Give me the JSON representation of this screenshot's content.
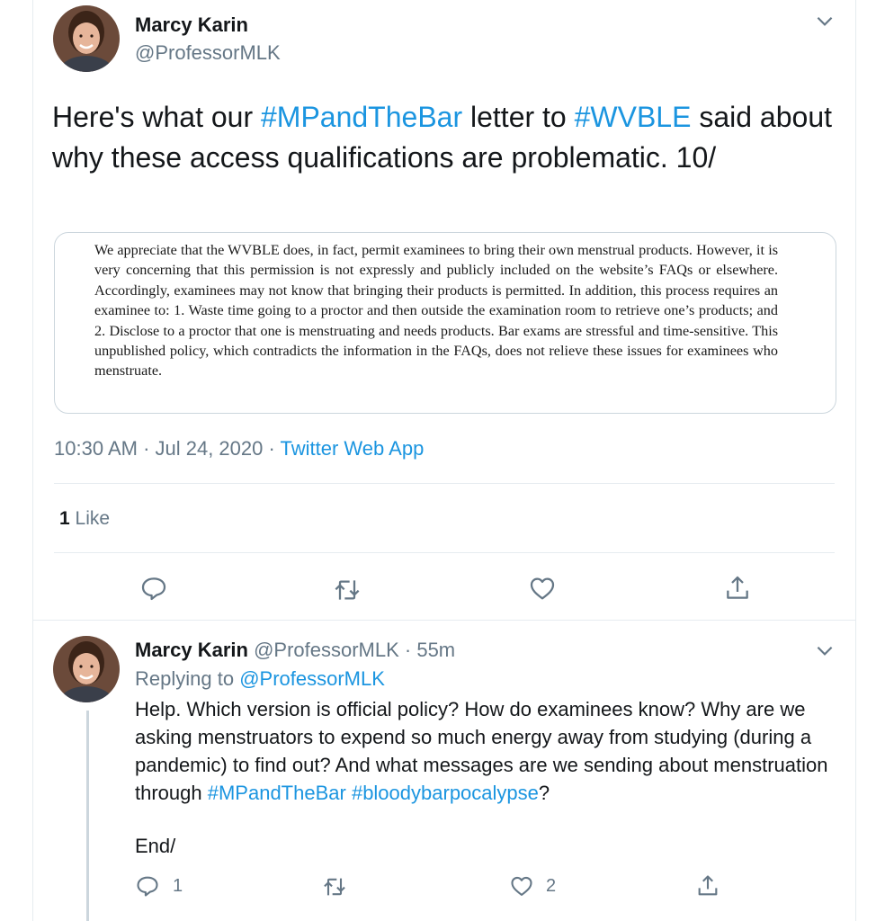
{
  "main_tweet": {
    "author_name": "Marcy Karin",
    "author_handle": "@ProfessorMLK",
    "text_before_1": "Here's what our ",
    "hashtag_1": "#MPandTheBar",
    "text_mid": " letter to ",
    "hashtag_2": "#WVBLE",
    "text_after": " said about why these access qualifications are problematic. 10/",
    "document_excerpt": "We appreciate that the WVBLE does, in fact, permit examinees to bring their own menstrual products. However, it is very concerning that this permission is not expressly and publicly included on the website’s FAQs or elsewhere. Accordingly, examinees may not know that bringing their products is permitted. In addition, this process requires an examinee to: 1. Waste time going to a proctor and then outside the examination room to retrieve one’s products; and 2. Disclose to a proctor that one is menstruating and needs products. Bar exams are stressful and time-sensitive. This unpublished policy, which contradicts the information in the FAQs, does not relieve these issues for examinees who menstruate.",
    "timestamp": "10:30 AM · Jul 24, 2020 · ",
    "app": "Twitter Web App",
    "like_count": "1",
    "like_label": " Like"
  },
  "reply_tweet": {
    "author_name": "Marcy Karin",
    "author_meta": " @ProfessorMLK · 55m",
    "replying_label": "Replying to ",
    "replying_handle": "@ProfessorMLK",
    "text_before": "Help. Which version is official policy?  How do examinees know?  Why are we asking menstruators to expend so much energy away from studying (during a pandemic) to find out? And what messages are we sending about menstruation through ",
    "hashtag_1": "#MPandTheBar",
    "space": " ",
    "hashtag_2": "#bloodybarpocalypse",
    "text_after": "?",
    "end_text": "End/",
    "reply_count": "1",
    "like_count": "2"
  },
  "icons": {
    "reply": "reply-icon",
    "retweet": "retweet-icon",
    "like": "heart-icon",
    "share": "share-icon",
    "more": "chevron-down-icon"
  },
  "colors": {
    "link": "#1b95e0",
    "secondary": "#657786",
    "border": "#e6ecf0"
  }
}
